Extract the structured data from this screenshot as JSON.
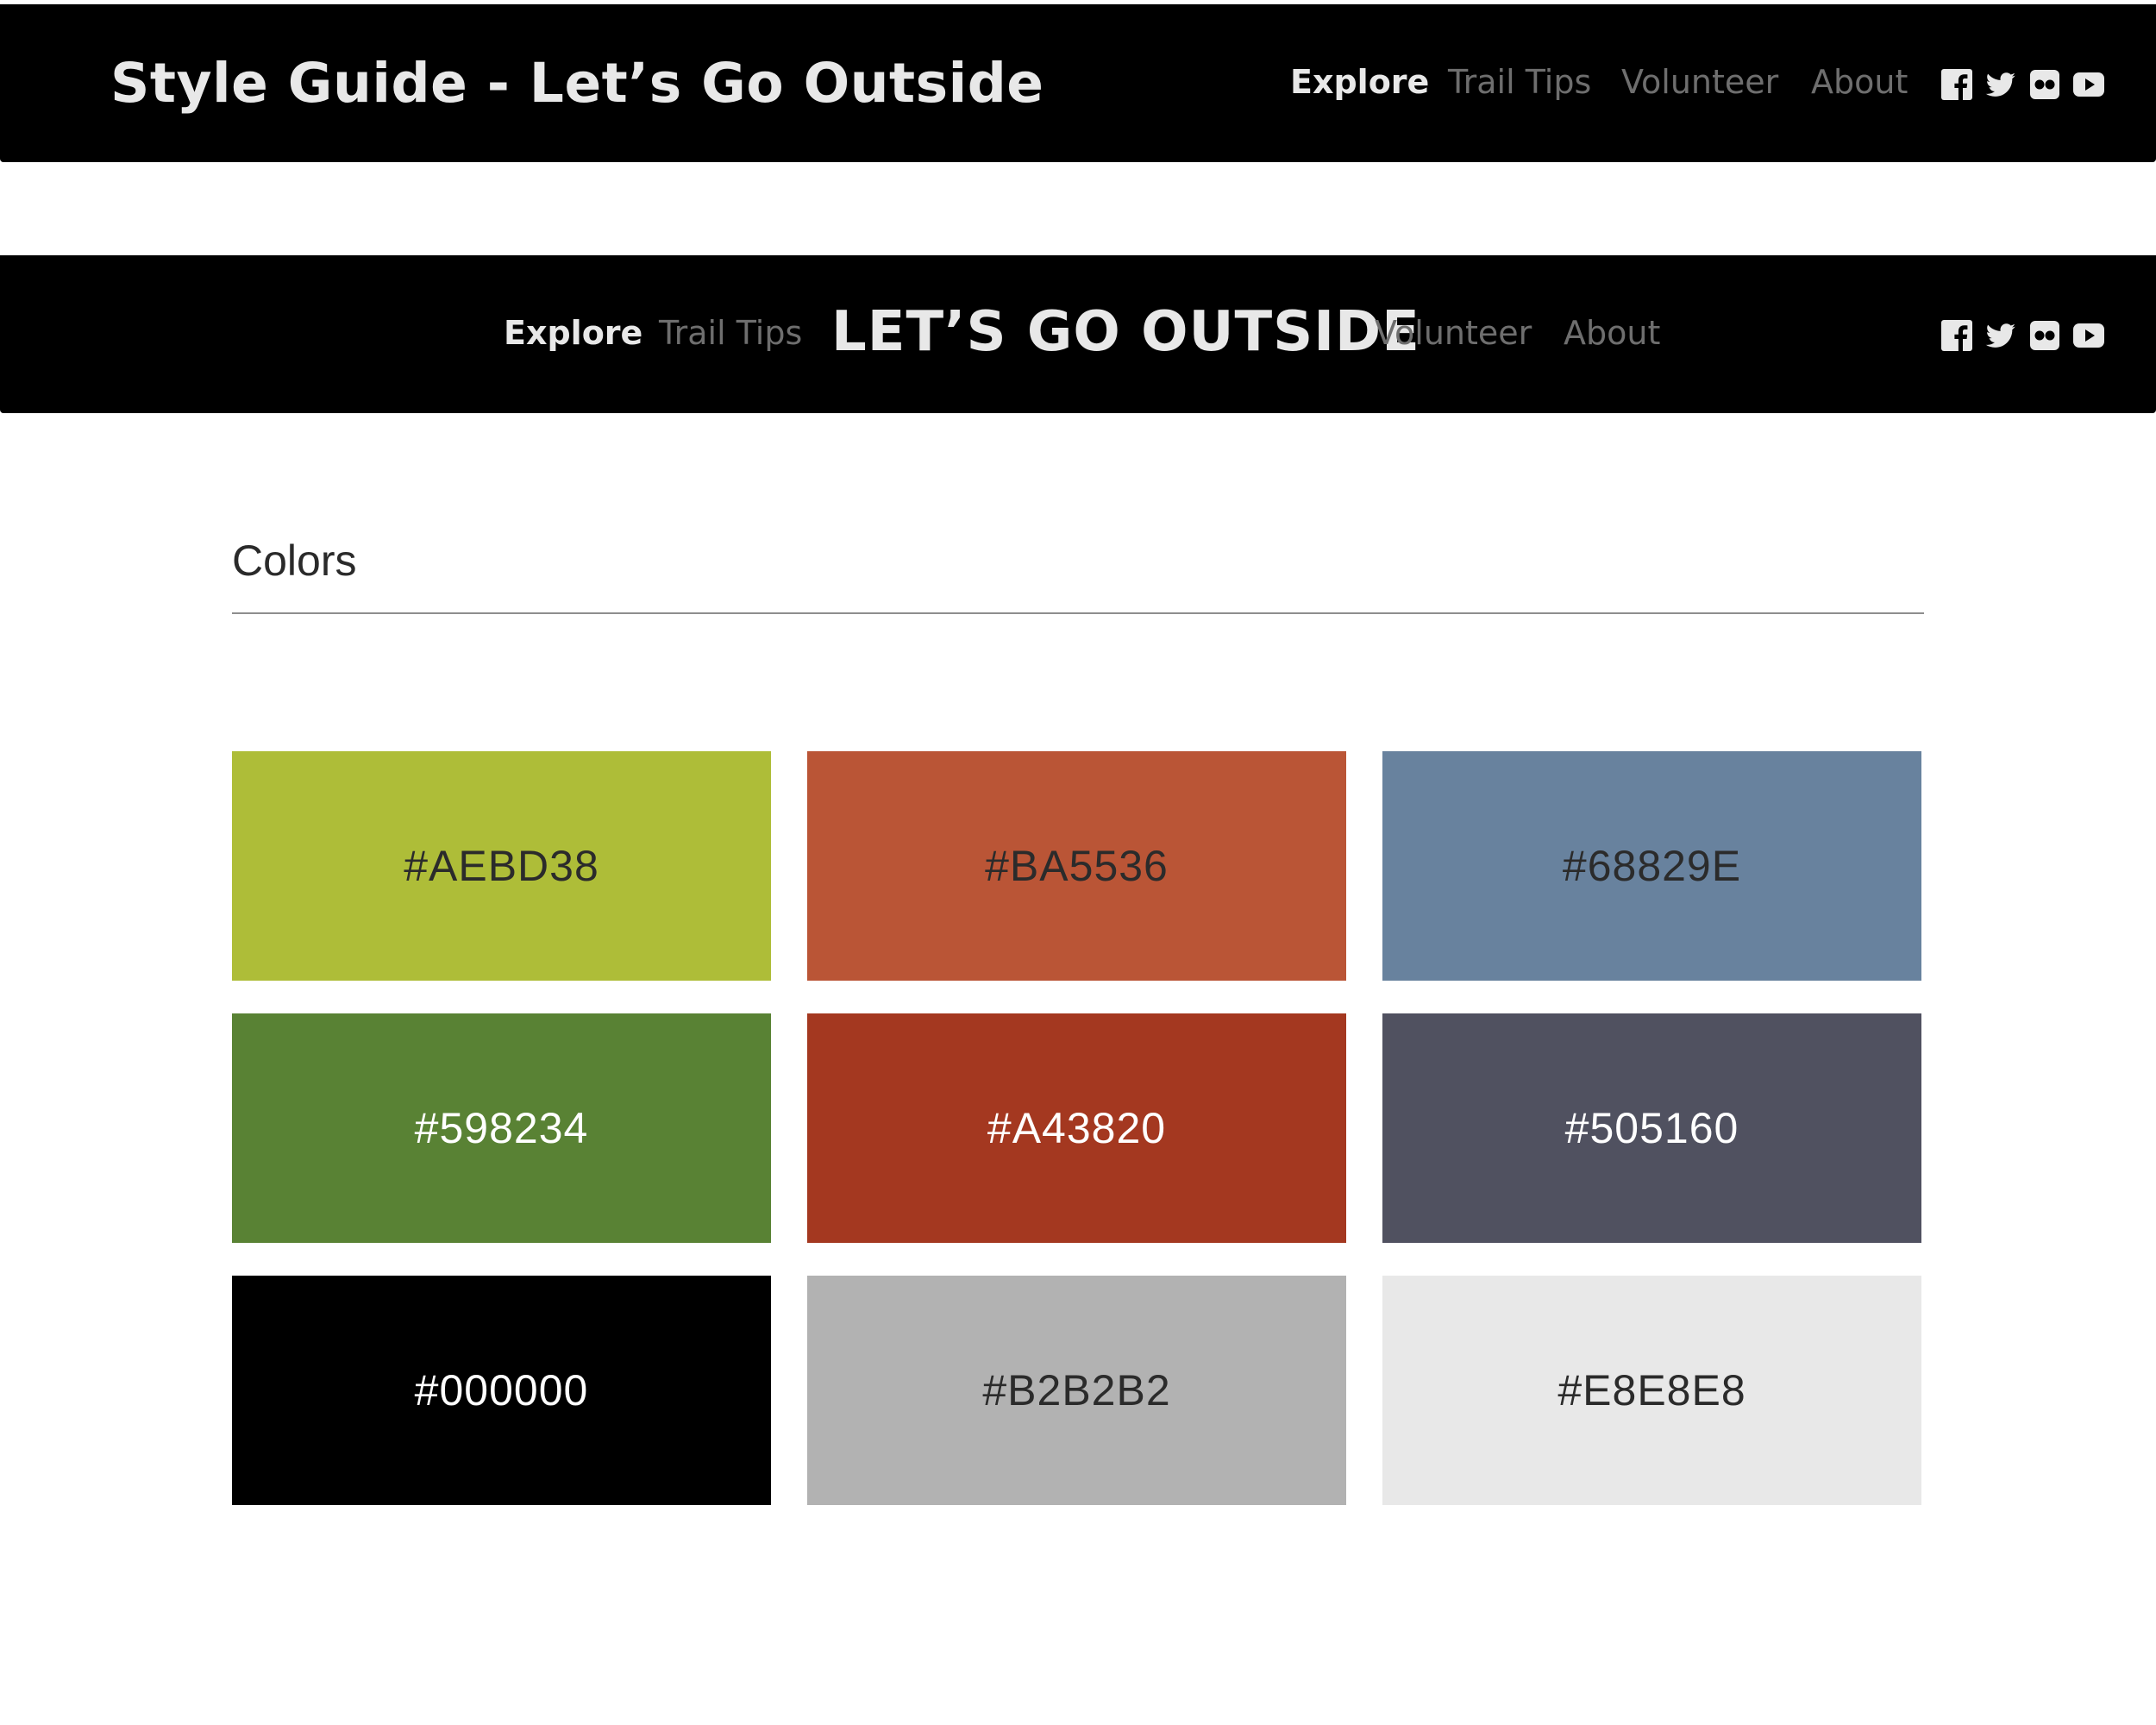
{
  "header_one": {
    "title": "Style Guide - Let’s Go Outside",
    "nav": {
      "explore": "Explore",
      "trail_tips": "Trail Tips",
      "volunteer": "Volunteer",
      "about": "About"
    },
    "social_icons": [
      "facebook-icon",
      "twitter-icon",
      "flickr-icon",
      "youtube-icon"
    ]
  },
  "header_two": {
    "title": "LET’S GO OUTSIDE",
    "nav": {
      "explore": "Explore",
      "trail_tips": "Trail Tips",
      "volunteer": "Volunteer",
      "about": "About"
    },
    "social_icons": [
      "facebook-icon",
      "twitter-icon",
      "flickr-icon",
      "youtube-icon"
    ]
  },
  "colors_section": {
    "heading": "Colors",
    "swatches": [
      {
        "label": "#AEBD38",
        "color": "#AEBD38"
      },
      {
        "label": "#BA5536",
        "color": "#BA5536"
      },
      {
        "label": "#68829E",
        "color": "#68829E"
      },
      {
        "label": "#598234",
        "color": "#598234"
      },
      {
        "label": "#A43820",
        "color": "#A43820"
      },
      {
        "label": "#505160",
        "color": "#505160"
      },
      {
        "label": "#000000",
        "color": "#000000"
      },
      {
        "label": "#B2B2B2",
        "color": "#B2B2B2"
      },
      {
        "label": "#E8E8E8",
        "color": "#E8E8E8"
      }
    ]
  }
}
